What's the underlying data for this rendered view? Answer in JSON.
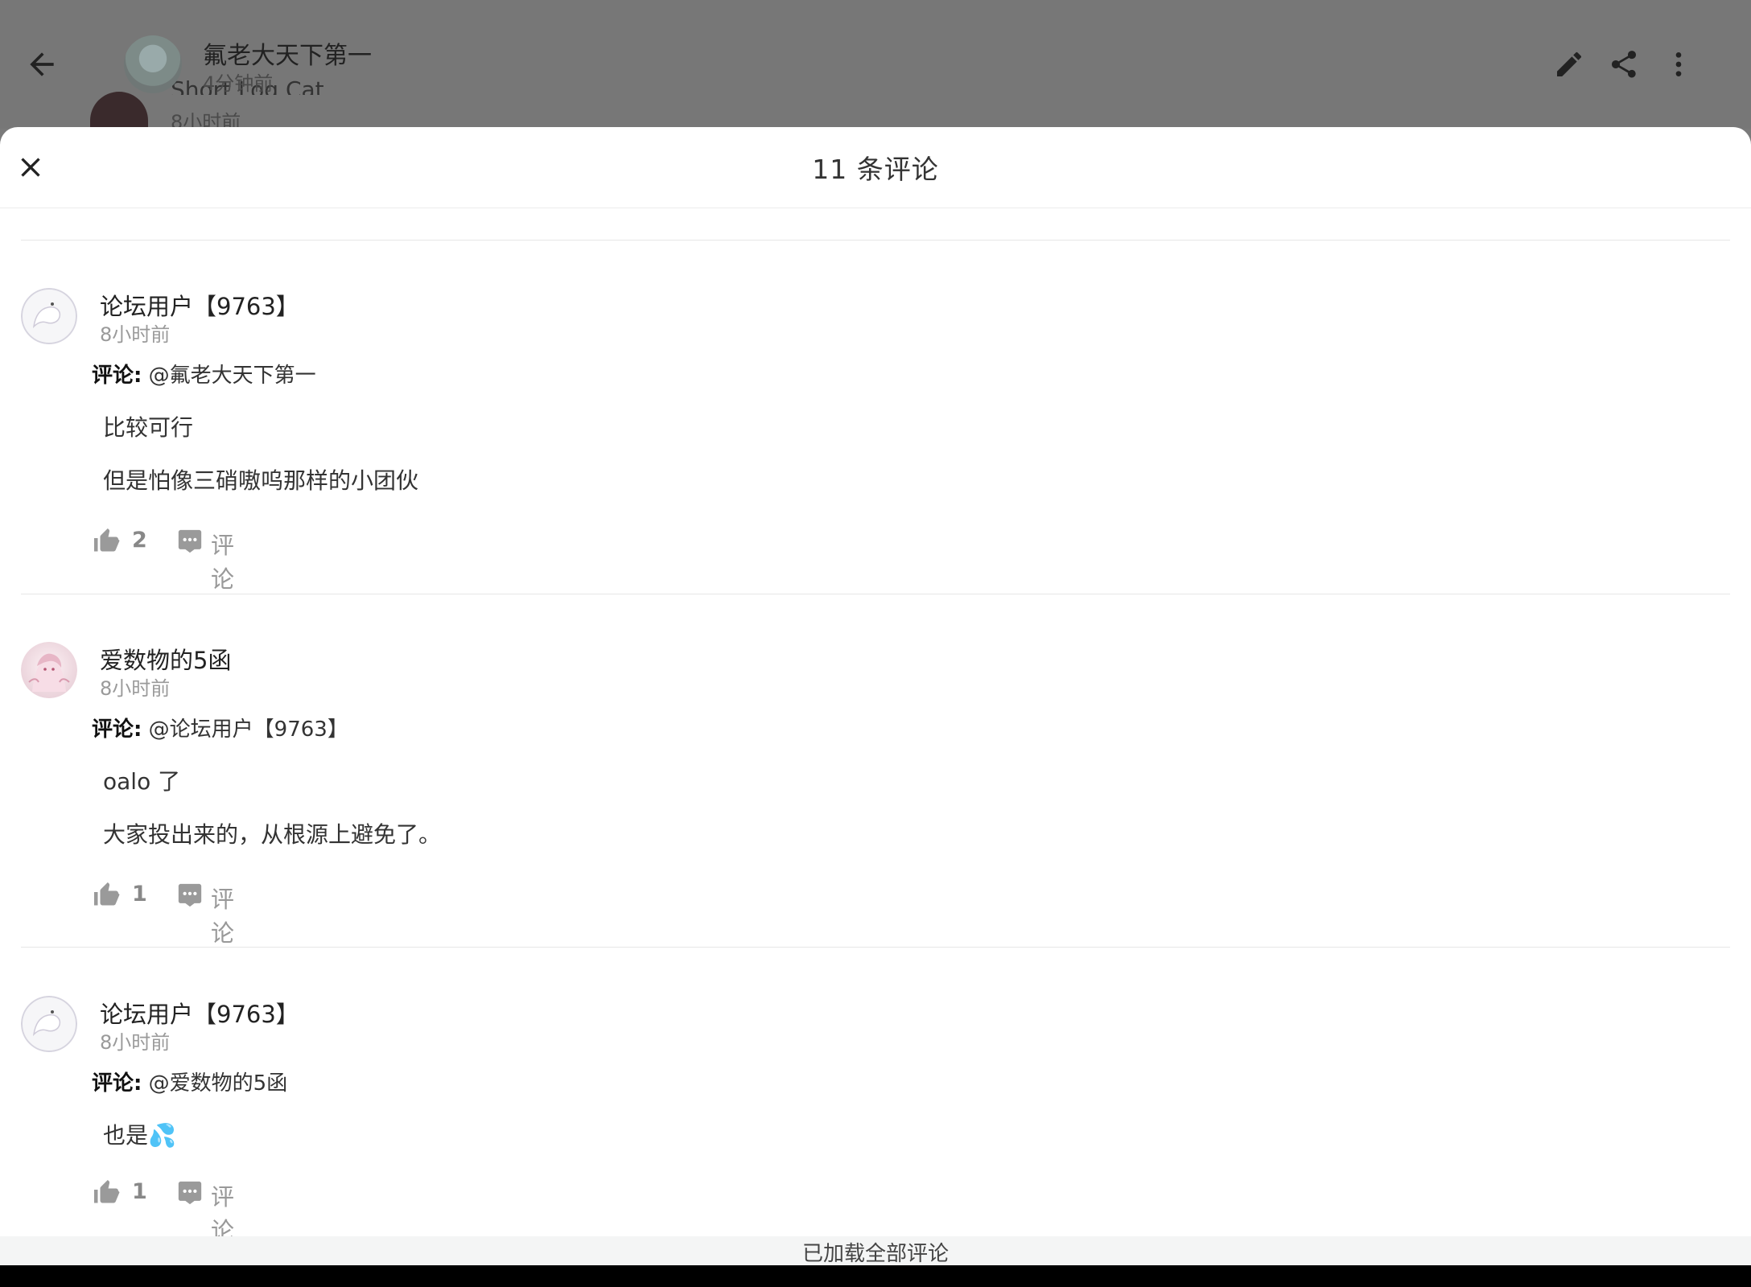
{
  "background": {
    "author": "氟老大天下第一",
    "time": "4分钟前",
    "ghost_name": "Short Log Cat",
    "ghost_time": "8小时前"
  },
  "sheet": {
    "title": "11 条评论",
    "footer": "已加载全部评论"
  },
  "comments": [
    {
      "name": "论坛用户【9763】",
      "time": "8小时前",
      "reply_prefix": "评论:",
      "reply_to": "@氟老大天下第一",
      "lines": [
        "比较可行",
        "但是怕像三硝嗷呜那样的小团伙"
      ],
      "likes": "2",
      "comment_label": "评论"
    },
    {
      "name": "爱数物的5函",
      "time": "8小时前",
      "reply_prefix": "评论:",
      "reply_to": "@论坛用户【9763】",
      "lines": [
        "oalo 了",
        "大家投出来的，从根源上避免了。"
      ],
      "likes": "1",
      "comment_label": "评论"
    },
    {
      "name": "论坛用户【9763】",
      "time": "8小时前",
      "reply_prefix": "评论:",
      "reply_to": "@爱数物的5函",
      "lines": [
        "也是💦"
      ],
      "likes": "1",
      "comment_label": "评论"
    }
  ],
  "colors": {
    "like_icon": "#9a9a9a",
    "comment_icon": "#9a9a9a",
    "dim_overlay": "#777777"
  }
}
